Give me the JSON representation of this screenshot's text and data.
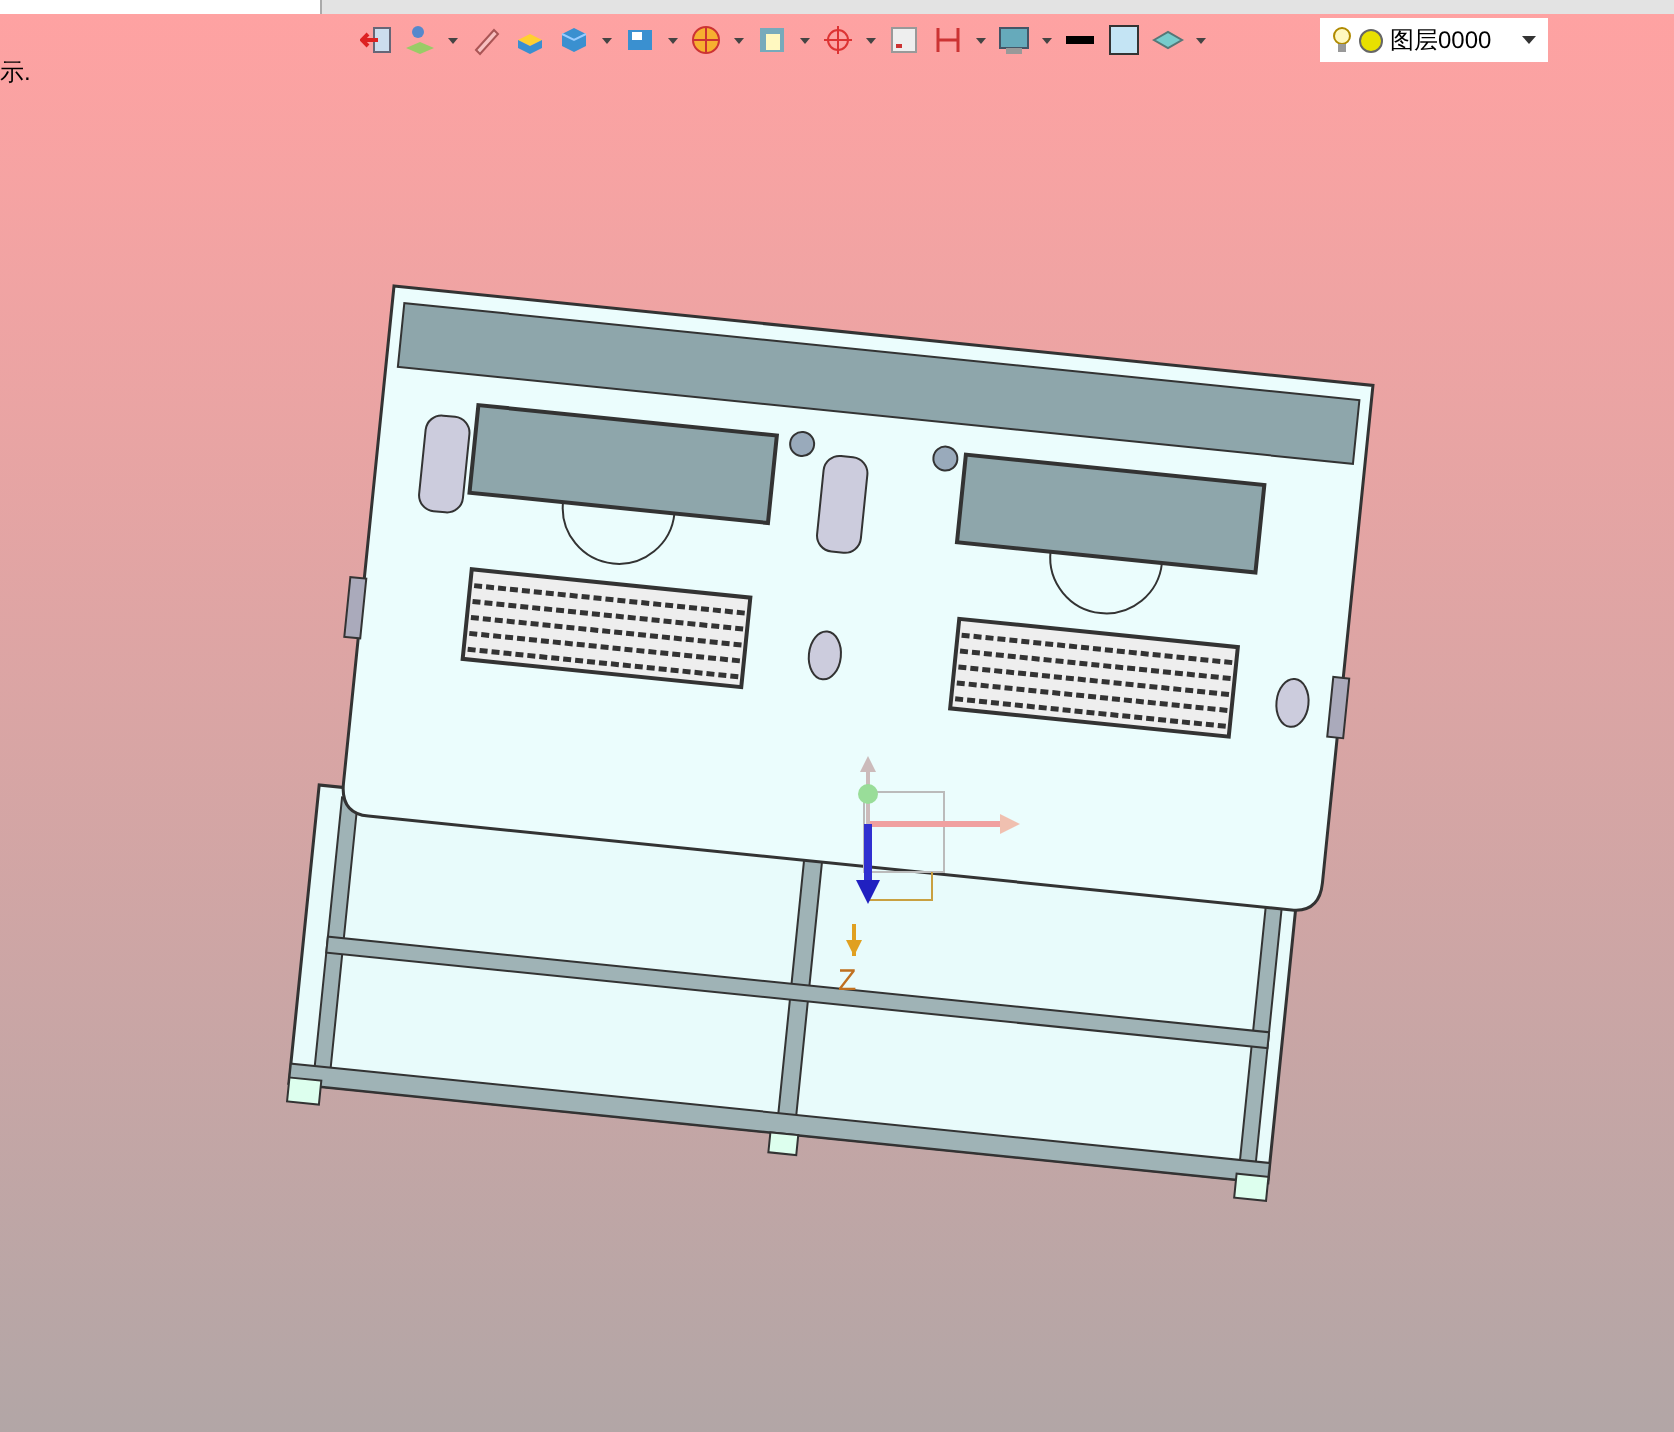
{
  "prompt": "示.",
  "layer_selector": {
    "value": "图层0000"
  },
  "axis_label": "Z"
}
